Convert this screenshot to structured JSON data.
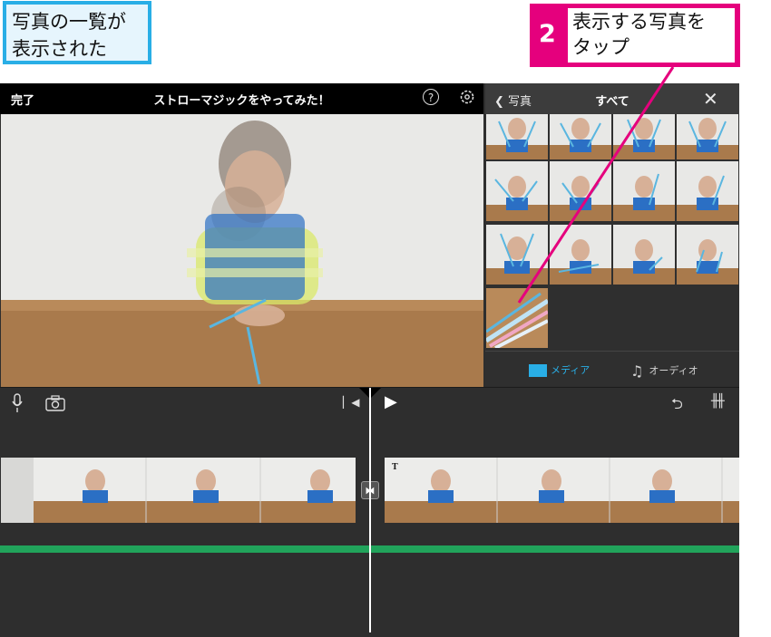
{
  "callouts": {
    "left_line1": "写真の一覧が",
    "left_line2": "表示された",
    "step_number": "2",
    "right_line1": "表示する写真を",
    "right_line2": "タップ"
  },
  "topbar": {
    "done_label": "完了",
    "title": "ストローマジックをやってみた！",
    "help_glyph": "?"
  },
  "media_panel": {
    "back_label": "写真",
    "header_title": "すべて",
    "close_glyph": "✕",
    "tabs": [
      {
        "label": "メディア",
        "active": true
      },
      {
        "label": "オーディオ",
        "active": false
      }
    ]
  },
  "timeline": {
    "title_marker": "T",
    "transition_glyph": "⧓"
  },
  "colors": {
    "callout_pink": "#e5007d",
    "callout_blue": "#29aee6",
    "audio_green": "#21a35b",
    "accent_blue": "#29aee6"
  }
}
